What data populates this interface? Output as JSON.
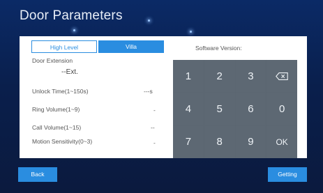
{
  "title": "Door Parameters",
  "tabs": {
    "high_level": "High Level",
    "villa": "Villa"
  },
  "software_version_label": "Software Version:",
  "fields": {
    "door_extension_label": "Door Extension",
    "door_extension_value": "--Ext.",
    "unlock_time_label": "Unlock Time(1~150s)",
    "unlock_time_value": "---s",
    "ring_volume_label": "Ring Volume(1~9)",
    "ring_volume_value": "-",
    "call_volume_label": "Call Volume(1~15)",
    "call_volume_value": "--",
    "motion_sensitivity_label": "Motion Sensitivity(0~3)",
    "motion_sensitivity_value": "-"
  },
  "keypad": {
    "k1": "1",
    "k2": "2",
    "k3": "3",
    "k4": "4",
    "k5": "5",
    "k6": "6",
    "k7": "7",
    "k8": "8",
    "k9": "9",
    "k0": "0",
    "ok": "OK",
    "backspace_icon": "backspace-icon"
  },
  "buttons": {
    "back": "Back",
    "getting": "Getting"
  },
  "colors": {
    "accent": "#2a8de0",
    "keypad": "#5d6873",
    "background": "#0b2a66"
  }
}
